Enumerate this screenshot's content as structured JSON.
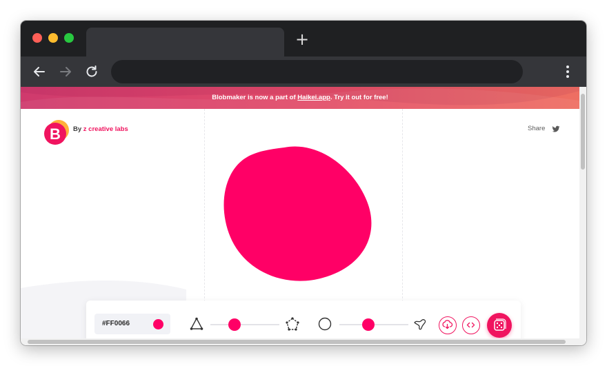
{
  "browser": {
    "window_controls": [
      "close",
      "minimize",
      "maximize"
    ],
    "new_tab_label": "+",
    "address_value": "",
    "nav_icons": [
      "back-arrow-icon",
      "forward-arrow-icon",
      "reload-icon",
      "menu-dots-icon"
    ]
  },
  "banner": {
    "prefix": "Blobmaker is now a part of ",
    "link_text": "Haikei.app",
    "suffix": ". Try it out for free!"
  },
  "header": {
    "logo_letter": "B",
    "by_label": "By ",
    "brand_name": "z creative labs",
    "share_label": "Share",
    "share_icon": "twitter-icon"
  },
  "blob": {
    "color": "#FF0066"
  },
  "controls": {
    "color_value": "#FF0066",
    "swatch_color": "#FF0066",
    "complexity_slider_value": 0.35,
    "contrast_slider_value": 0.42,
    "icons": [
      "triangle-icon",
      "polygon-icon",
      "circle-icon",
      "blob-shape-icon",
      "download-icon",
      "code-icon",
      "random-dice-icon"
    ]
  },
  "colors": {
    "accent": "#F0145F",
    "banner_start": "#CF3A6D",
    "banner_end": "#EE6F62",
    "chrome_dark": "#1F2022",
    "chrome_toolbar": "#35363A"
  }
}
